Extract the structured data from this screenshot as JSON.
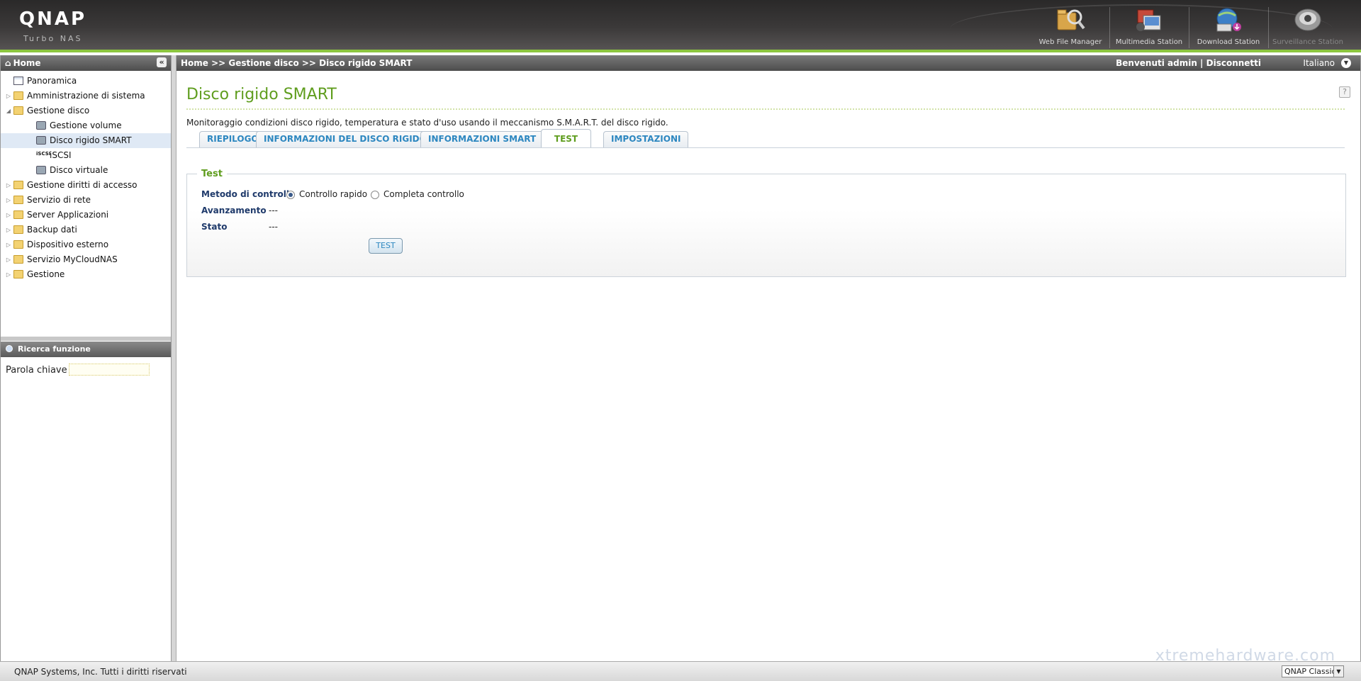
{
  "header": {
    "brand": "QNAP",
    "subtitle": "Turbo NAS",
    "apps": [
      {
        "label": "Web File Manager",
        "icon": "web-file-manager-icon"
      },
      {
        "label": "Multimedia Station",
        "icon": "multimedia-station-icon"
      },
      {
        "label": "Download Station",
        "icon": "download-station-icon"
      },
      {
        "label": "Surveillance Station",
        "icon": "surveillance-station-icon"
      }
    ]
  },
  "sidebar": {
    "title": "Home",
    "items": [
      {
        "label": "Panoramica",
        "icon": "overview-icon",
        "level": 0,
        "expander": ""
      },
      {
        "label": "Amministrazione di sistema",
        "icon": "folder-icon",
        "level": 0,
        "expander": "collapsed"
      },
      {
        "label": "Gestione disco",
        "icon": "folder-open-icon",
        "level": 0,
        "expander": "expanded"
      },
      {
        "label": "Gestione volume",
        "icon": "volume-icon",
        "level": 1,
        "expander": ""
      },
      {
        "label": "Disco rigido SMART",
        "icon": "smart-disk-icon",
        "level": 1,
        "expander": "",
        "selected": true
      },
      {
        "label": "iSCSI",
        "icon": "iscsi-icon",
        "level": 1,
        "expander": ""
      },
      {
        "label": "Disco virtuale",
        "icon": "virtual-disk-icon",
        "level": 1,
        "expander": ""
      },
      {
        "label": "Gestione diritti di accesso",
        "icon": "folder-icon",
        "level": 0,
        "expander": "collapsed"
      },
      {
        "label": "Servizio di rete",
        "icon": "folder-icon",
        "level": 0,
        "expander": "collapsed"
      },
      {
        "label": "Server Applicazioni",
        "icon": "folder-icon",
        "level": 0,
        "expander": "collapsed"
      },
      {
        "label": "Backup dati",
        "icon": "folder-icon",
        "level": 0,
        "expander": "collapsed"
      },
      {
        "label": "Dispositivo esterno",
        "icon": "folder-icon",
        "level": 0,
        "expander": "collapsed"
      },
      {
        "label": "Servizio MyCloudNAS",
        "icon": "folder-icon",
        "level": 0,
        "expander": "collapsed"
      },
      {
        "label": "Gestione",
        "icon": "folder-icon",
        "level": 0,
        "expander": "collapsed"
      }
    ],
    "search": {
      "title": "Ricerca funzione",
      "keyword_label": "Parola chiave :",
      "keyword_value": ""
    }
  },
  "topbar": {
    "breadcrumb": "Home >> Gestione disco >> Disco rigido SMART",
    "welcome": "Benvenuti admin | Disconnetti",
    "language": "Italiano"
  },
  "page": {
    "title": "Disco rigido SMART",
    "description": "Monitoraggio condizioni disco rigido, temperatura e stato d'uso usando il meccanismo S.M.A.R.T. del disco rigido.",
    "tabs": [
      {
        "label": "RIEPILOGO",
        "active": false
      },
      {
        "label": "INFORMAZIONI DEL DISCO RIGIDO",
        "active": false
      },
      {
        "label": "INFORMAZIONI SMART",
        "active": false
      },
      {
        "label": "TEST",
        "active": true
      },
      {
        "label": "IMPOSTAZIONI",
        "active": false
      }
    ],
    "test": {
      "legend": "Test",
      "method_label": "Metodo di controllo",
      "method_options": [
        {
          "label": "Controllo rapido",
          "selected": true
        },
        {
          "label": "Completa controllo",
          "selected": false
        }
      ],
      "progress_label": "Avanzamento",
      "progress_value": "---",
      "status_label": "Stato",
      "status_value": "---",
      "button_label": "TEST"
    }
  },
  "footer": {
    "copyright": "QNAP Systems, Inc. Tutti i diritti riservati",
    "theme": "QNAP Classic",
    "watermark": "xtremehardware.com"
  },
  "colors": {
    "accent_green": "#5f9d1e",
    "tab_blue": "#2d87c0",
    "header_dark": "#3b3939",
    "header_border": "#8cc63f"
  }
}
